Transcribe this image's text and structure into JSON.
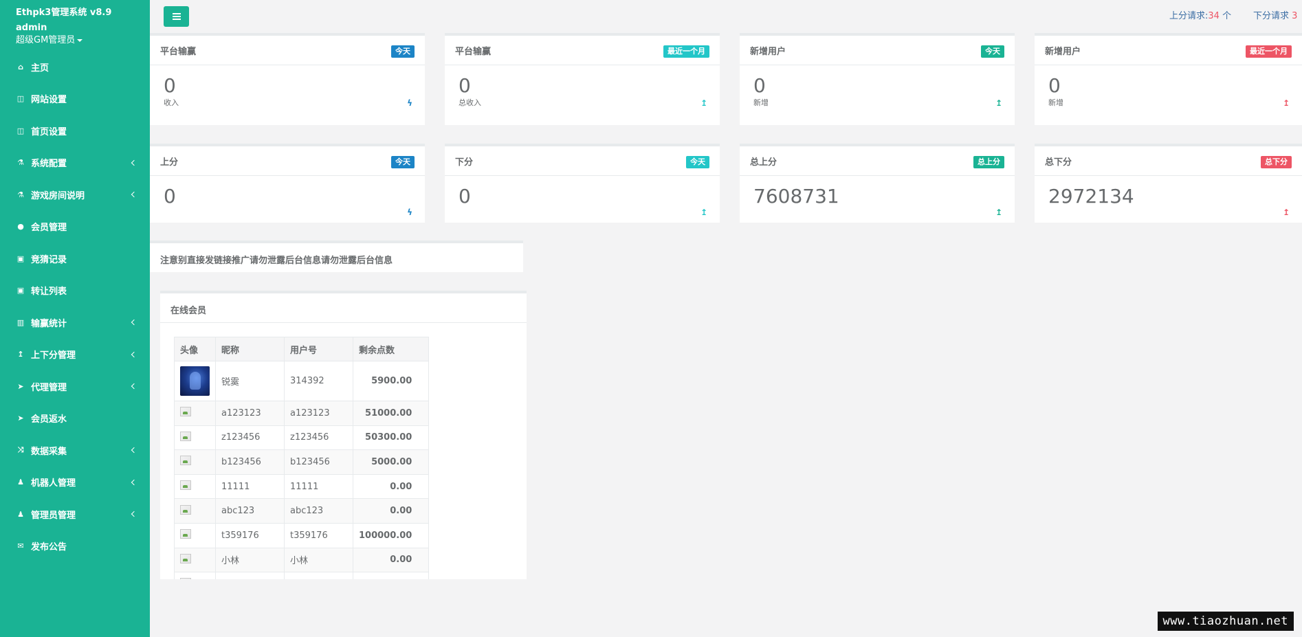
{
  "brand": {
    "title": "Ethpk3管理系统 v8.9",
    "user": "admin",
    "role": "超级GM管理员"
  },
  "nav": [
    {
      "label": "主页",
      "icon": "home-icon",
      "glyph": "⌂",
      "expandable": false
    },
    {
      "label": "网站设置",
      "icon": "columns-icon",
      "glyph": "◫",
      "expandable": false
    },
    {
      "label": "首页设置",
      "icon": "columns-icon",
      "glyph": "◫",
      "expandable": false
    },
    {
      "label": "系统配置",
      "icon": "flask-icon",
      "glyph": "⚗",
      "expandable": true
    },
    {
      "label": "游戏房间说明",
      "icon": "flask-icon",
      "glyph": "⚗",
      "expandable": true
    },
    {
      "label": "会员管理",
      "icon": "user-icon",
      "glyph": "●",
      "expandable": false
    },
    {
      "label": "竞猜记录",
      "icon": "car-icon",
      "glyph": "▣",
      "expandable": false
    },
    {
      "label": "转让列表",
      "icon": "car-icon",
      "glyph": "▣",
      "expandable": false
    },
    {
      "label": "输赢统计",
      "icon": "bar-chart-icon",
      "glyph": "▥",
      "expandable": true
    },
    {
      "label": "上下分管理",
      "icon": "level-up-icon",
      "glyph": "↥",
      "expandable": true
    },
    {
      "label": "代理管理",
      "icon": "paper-plane-icon",
      "glyph": "➤",
      "expandable": true
    },
    {
      "label": "会员返水",
      "icon": "paper-plane-icon",
      "glyph": "➤",
      "expandable": false
    },
    {
      "label": "数据采集",
      "icon": "random-icon",
      "glyph": "⤨",
      "expandable": true
    },
    {
      "label": "机器人管理",
      "icon": "male-icon",
      "glyph": "♟",
      "expandable": true
    },
    {
      "label": "管理员管理",
      "icon": "male-icon",
      "glyph": "♟",
      "expandable": true
    },
    {
      "label": "发布公告",
      "icon": "comment-icon",
      "glyph": "✉",
      "expandable": false
    }
  ],
  "topbar": {
    "up_request_label": "上分请求:",
    "up_request_count": "34",
    "up_request_unit": " 个",
    "down_request_label": "下分请求",
    "down_request_count": "3"
  },
  "stats_row1": [
    {
      "title": "平台输赢",
      "badge": "今天",
      "badge_color": "#1c84c6",
      "value": "0",
      "sub": "收入",
      "arrow": "ϟ",
      "arrow_color": "#1c84c6"
    },
    {
      "title": "平台输赢",
      "badge": "最近一个月",
      "badge_color": "#23c6c8",
      "value": "0",
      "sub": "总收入",
      "arrow": "↥",
      "arrow_color": "#23c6c8"
    },
    {
      "title": "新增用户",
      "badge": "今天",
      "badge_color": "#1ab394",
      "value": "0",
      "sub": "新增",
      "arrow": "↥",
      "arrow_color": "#1ab394"
    },
    {
      "title": "新增用户",
      "badge": "最近一个月",
      "badge_color": "#ed5565",
      "value": "0",
      "sub": "新增",
      "arrow": "↥",
      "arrow_color": "#ed5565"
    }
  ],
  "stats_row2": [
    {
      "title": "上分",
      "badge": "今天",
      "badge_color": "#1c84c6",
      "value": "0",
      "arrow": "ϟ",
      "arrow_color": "#1c84c6"
    },
    {
      "title": "下分",
      "badge": "今天",
      "badge_color": "#23c6c8",
      "value": "0",
      "arrow": "↥",
      "arrow_color": "#23c6c8"
    },
    {
      "title": "总上分",
      "badge": "总上分",
      "badge_color": "#1ab394",
      "value": "7608731",
      "arrow": "↥",
      "arrow_color": "#1ab394"
    },
    {
      "title": "总下分",
      "badge": "总下分",
      "badge_color": "#ed5565",
      "value": "2972134",
      "arrow": "↥",
      "arrow_color": "#ed5565"
    }
  ],
  "notice": "注意别直接发链接推广请勿泄露后台信息请勿泄露后台信息",
  "online": {
    "title": "在线会员",
    "columns": [
      "头像",
      "昵称",
      "用户号",
      "剩余点数"
    ],
    "rows": [
      {
        "avatar": "photo",
        "nickname": "锐霙",
        "user_id": "314392",
        "points": "5900.00"
      },
      {
        "avatar": "broken",
        "nickname": "a123123",
        "user_id": "a123123",
        "points": "51000.00"
      },
      {
        "avatar": "broken",
        "nickname": "z123456",
        "user_id": "z123456",
        "points": "50300.00"
      },
      {
        "avatar": "broken",
        "nickname": "b123456",
        "user_id": "b123456",
        "points": "5000.00"
      },
      {
        "avatar": "broken",
        "nickname": "11111",
        "user_id": "11111",
        "points": "0.00"
      },
      {
        "avatar": "broken",
        "nickname": "abc123",
        "user_id": "abc123",
        "points": "0.00"
      },
      {
        "avatar": "broken",
        "nickname": "t359176",
        "user_id": "t359176",
        "points": "100000.00"
      },
      {
        "avatar": "broken",
        "nickname": "小林",
        "user_id": "小林",
        "points": "0.00"
      },
      {
        "avatar": "broken",
        "nickname": "",
        "user_id": "",
        "points": ""
      }
    ]
  },
  "watermark": "www.tiaozhuan.net"
}
